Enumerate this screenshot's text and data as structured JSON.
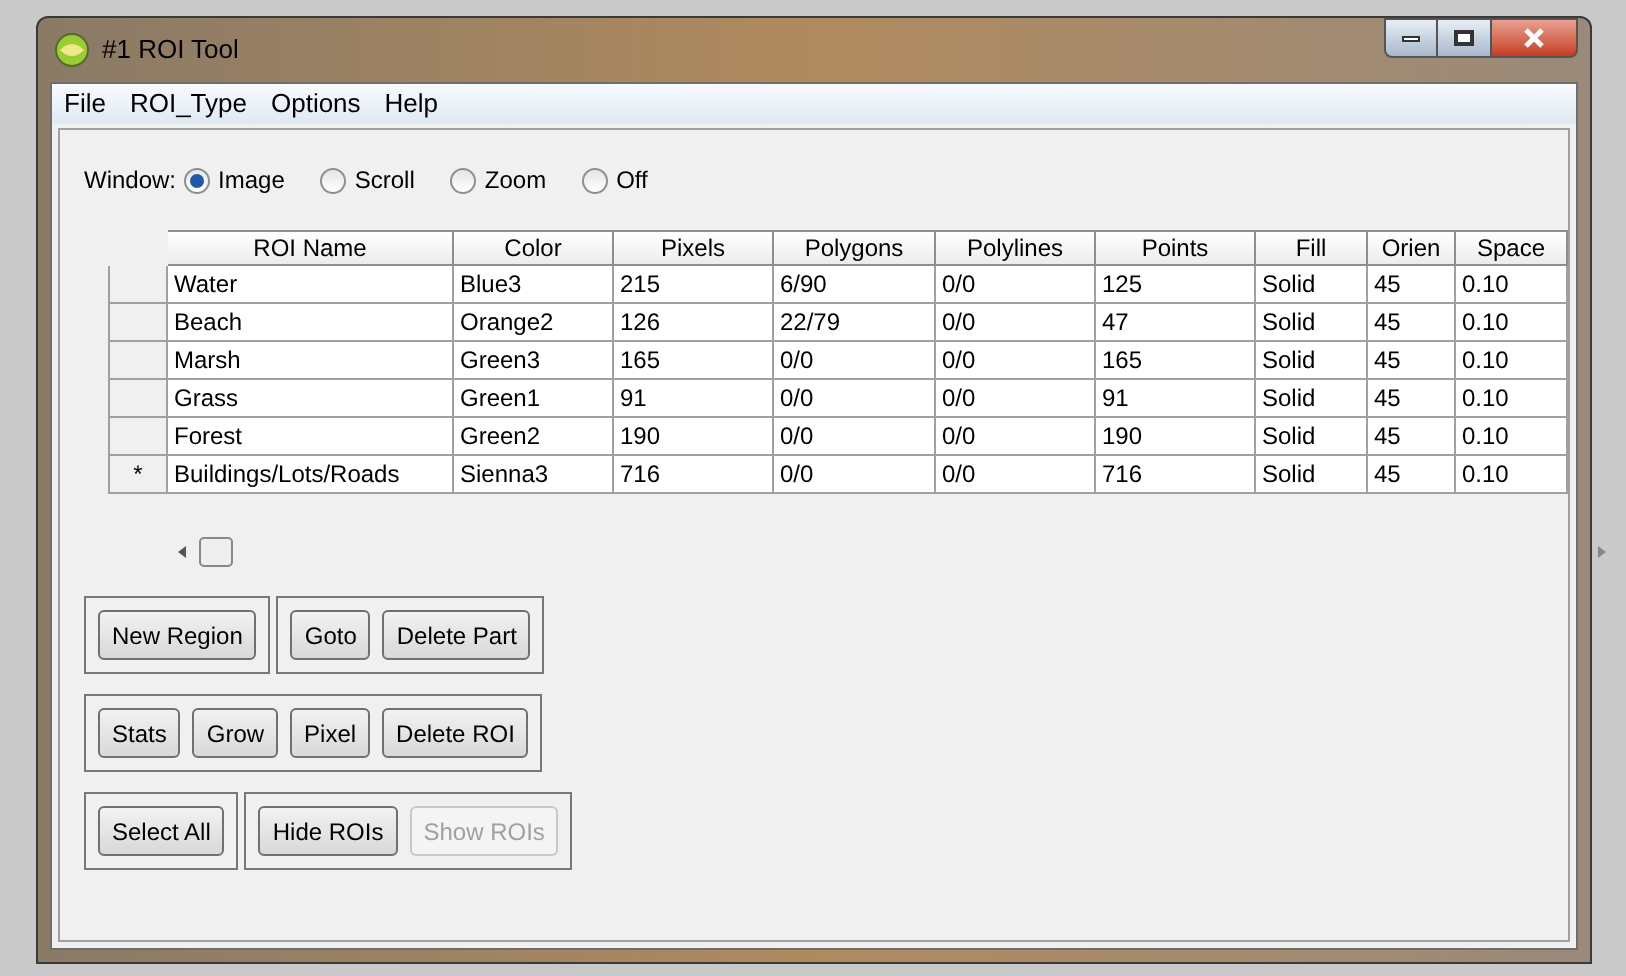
{
  "window": {
    "title": "#1 ROI Tool"
  },
  "menu": [
    "File",
    "ROI_Type",
    "Options",
    "Help"
  ],
  "window_mode": {
    "label": "Window:",
    "options": [
      {
        "label": "Image",
        "selected": true
      },
      {
        "label": "Scroll",
        "selected": false
      },
      {
        "label": "Zoom",
        "selected": false
      },
      {
        "label": "Off",
        "selected": false
      }
    ]
  },
  "table": {
    "columns": [
      "ROI Name",
      "Color",
      "Pixels",
      "Polygons",
      "Polylines",
      "Points",
      "Fill",
      "Orien",
      "Space"
    ],
    "rows": [
      {
        "marker": "",
        "cells": [
          "Water",
          "Blue3",
          "215",
          "6/90",
          "0/0",
          "125",
          "Solid",
          "45",
          "0.10"
        ]
      },
      {
        "marker": "",
        "cells": [
          "Beach",
          "Orange2",
          "126",
          "22/79",
          "0/0",
          "47",
          "Solid",
          "45",
          "0.10"
        ]
      },
      {
        "marker": "",
        "cells": [
          "Marsh",
          "Green3",
          "165",
          "0/0",
          "0/0",
          "165",
          "Solid",
          "45",
          "0.10"
        ]
      },
      {
        "marker": "",
        "cells": [
          "Grass",
          "Green1",
          "91",
          "0/0",
          "0/0",
          "91",
          "Solid",
          "45",
          "0.10"
        ]
      },
      {
        "marker": "",
        "cells": [
          "Forest",
          "Green2",
          "190",
          "0/0",
          "0/0",
          "190",
          "Solid",
          "45",
          "0.10"
        ]
      },
      {
        "marker": "*",
        "cells": [
          "Buildings/Lots/Roads",
          "Sienna3",
          "716",
          "0/0",
          "0/0",
          "716",
          "Solid",
          "45",
          "0.10"
        ]
      }
    ]
  },
  "button_rows": [
    [
      [
        {
          "label": "New Region",
          "disabled": false
        }
      ],
      [
        {
          "label": "Goto",
          "disabled": false
        },
        {
          "label": "Delete Part",
          "disabled": false
        }
      ]
    ],
    [
      [
        {
          "label": "Stats",
          "disabled": false
        },
        {
          "label": "Grow",
          "disabled": false
        },
        {
          "label": "Pixel",
          "disabled": false
        },
        {
          "label": "Delete ROI",
          "disabled": false
        }
      ]
    ],
    [
      [
        {
          "label": "Select All",
          "disabled": false
        }
      ],
      [
        {
          "label": "Hide ROIs",
          "disabled": false
        },
        {
          "label": "Show ROIs",
          "disabled": true
        }
      ]
    ]
  ]
}
